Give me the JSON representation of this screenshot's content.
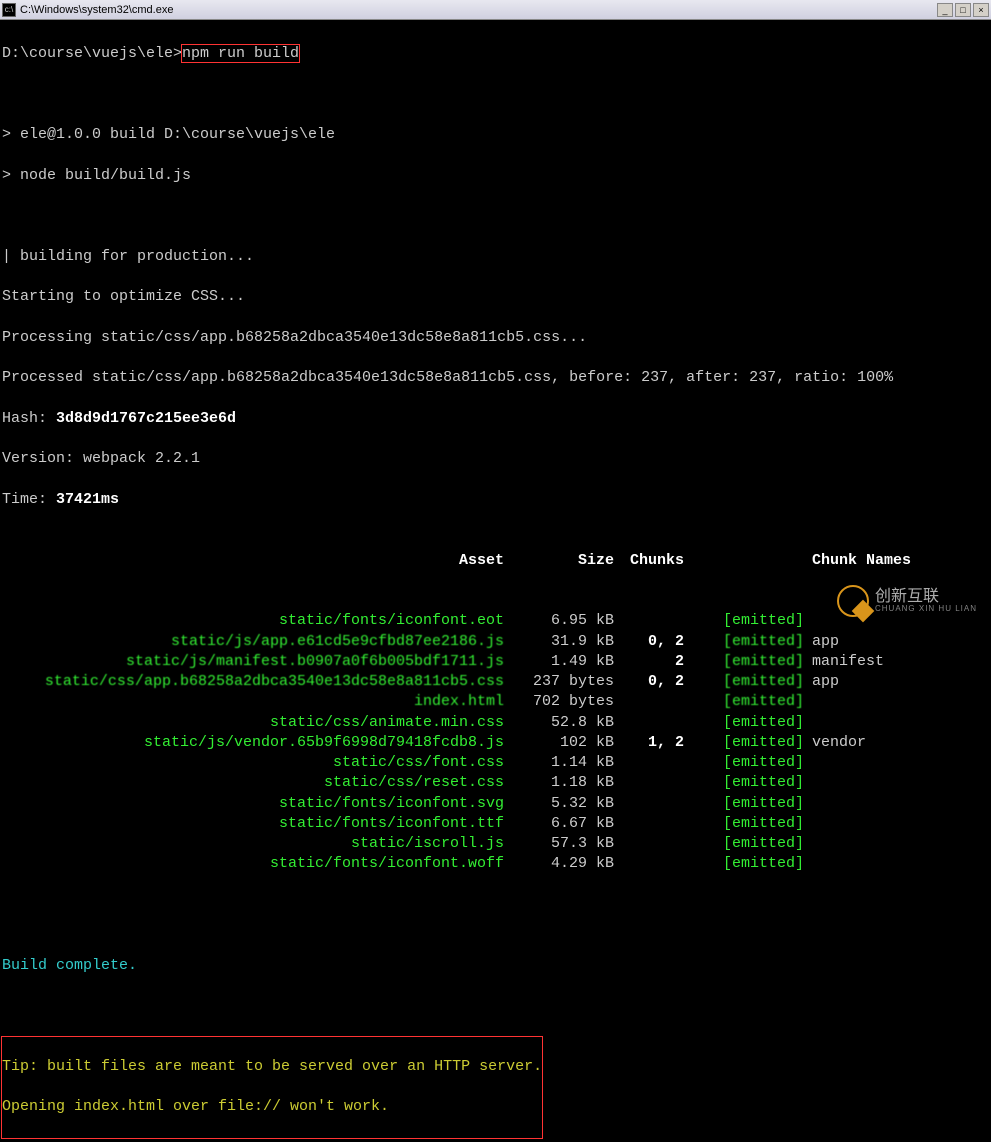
{
  "titlebar": {
    "path": "C:\\Windows\\system32\\cmd.exe"
  },
  "prompt_line": {
    "cwd": "D:\\course\\vuejs\\ele>",
    "cmd": "npm run build"
  },
  "script_lines": [
    "> ele@1.0.0 build D:\\course\\vuejs\\ele",
    "> node build/build.js"
  ],
  "build_lines": [
    "| building for production...",
    "Starting to optimize CSS...",
    "Processing static/css/app.b68258a2dbca3540e13dc58e8a811cb5.css...",
    "Processed static/css/app.b68258a2dbca3540e13dc58e8a811cb5.css, before: 237, after: 237, ratio: 100%"
  ],
  "hash": {
    "label": "Hash: ",
    "value": "3d8d9d1767c215ee3e6d"
  },
  "version": {
    "label": "Version: ",
    "value": "webpack 2.2.1"
  },
  "time": {
    "label": "Time: ",
    "value": "37421ms"
  },
  "table_headers": {
    "asset": "Asset",
    "size": "Size",
    "chunks": "Chunks",
    "emit_blank": "",
    "name": "Chunk Names"
  },
  "rows": [
    {
      "asset": "static/fonts/iconfont.eot",
      "size": "6.95 kB",
      "chunks": "",
      "emit": "[emitted]",
      "name": ""
    },
    {
      "asset": "static/js/app.e61cd5e9cfbd87ee2186.js",
      "size": "31.9 kB",
      "chunks": "0, 2",
      "emit": "[emitted]",
      "name": "app"
    },
    {
      "asset": "static/js/manifest.b0907a0f6b005bdf1711.js",
      "size": "1.49 kB",
      "chunks": "2",
      "emit": "[emitted]",
      "name": "manifest"
    },
    {
      "asset": "static/css/app.b68258a2dbca3540e13dc58e8a811cb5.css",
      "size": "237 bytes",
      "chunks": "0, 2",
      "emit": "[emitted]",
      "name": "app"
    },
    {
      "asset": "index.html",
      "size": "702 bytes",
      "chunks": "",
      "emit": "[emitted]",
      "name": ""
    },
    {
      "asset": "static/css/animate.min.css",
      "size": "52.8 kB",
      "chunks": "",
      "emit": "[emitted]",
      "name": ""
    },
    {
      "asset": "static/js/vendor.65b9f6998d79418fcdb8.js",
      "size": "102 kB",
      "chunks": "1, 2",
      "emit": "[emitted]",
      "name": "vendor"
    },
    {
      "asset": "static/css/font.css",
      "size": "1.14 kB",
      "chunks": "",
      "emit": "[emitted]",
      "name": ""
    },
    {
      "asset": "static/css/reset.css",
      "size": "1.18 kB",
      "chunks": "",
      "emit": "[emitted]",
      "name": ""
    },
    {
      "asset": "static/fonts/iconfont.svg",
      "size": "5.32 kB",
      "chunks": "",
      "emit": "[emitted]",
      "name": ""
    },
    {
      "asset": "static/fonts/iconfont.ttf",
      "size": "6.67 kB",
      "chunks": "",
      "emit": "[emitted]",
      "name": ""
    },
    {
      "asset": "static/iscroll.js",
      "size": "57.3 kB",
      "chunks": "",
      "emit": "[emitted]",
      "name": ""
    },
    {
      "asset": "static/fonts/iconfont.woff",
      "size": "4.29 kB",
      "chunks": "",
      "emit": "[emitted]",
      "name": ""
    }
  ],
  "build_complete": "Build complete.",
  "tip": {
    "l1": "Tip: built files are meant to be served over an HTTP server.",
    "l2": "Opening index.html over file:// won't work."
  },
  "watermark": {
    "main": "创新互联",
    "sub": "CHUANG XIN HU LIAN"
  }
}
